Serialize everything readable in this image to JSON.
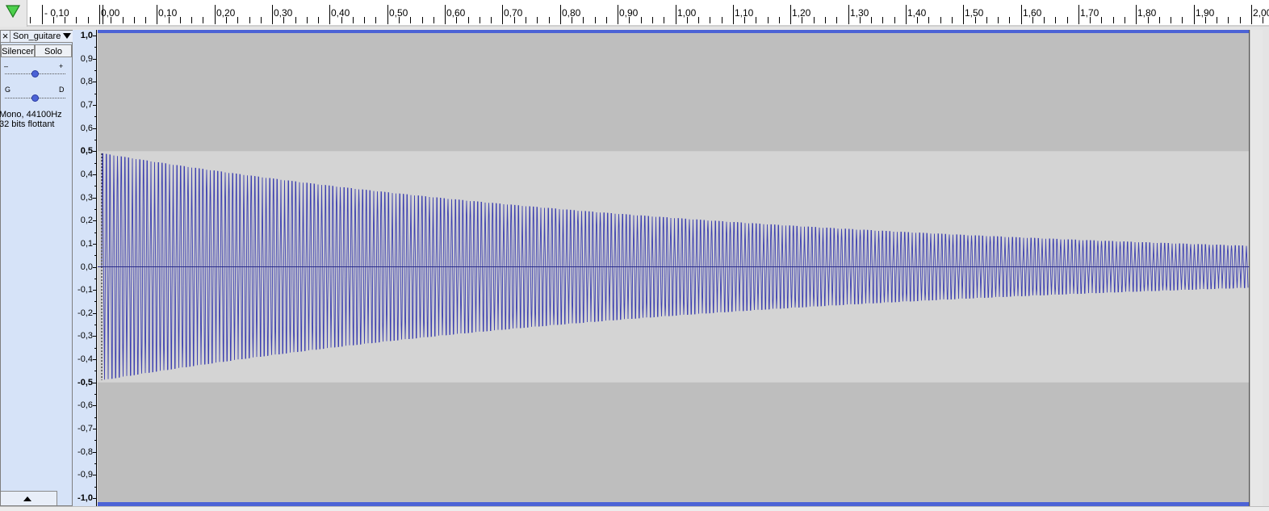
{
  "timeline": {
    "labels": [
      "- 0,10",
      "0,00",
      "0,10",
      "0,20",
      "0,30",
      "0,40",
      "0,50",
      "0,60",
      "0,70",
      "0,80",
      "0,90",
      "1,00",
      "1,10",
      "1,20",
      "1,30",
      "1,40",
      "1,50",
      "1,60",
      "1,70",
      "1,80",
      "1,90",
      "2,00"
    ],
    "values": [
      -0.1,
      0.0,
      0.1,
      0.2,
      0.3,
      0.4,
      0.5,
      0.6,
      0.7,
      0.8,
      0.9,
      1.0,
      1.1,
      1.2,
      1.3,
      1.4,
      1.5,
      1.6,
      1.7,
      1.8,
      1.9,
      2.0
    ]
  },
  "track": {
    "close_label": "×",
    "name": "Son_guitare",
    "mute_label": "Silencer",
    "solo_label": "Solo",
    "gain_minus": "–",
    "gain_plus": "+",
    "pan_left": "G",
    "pan_right": "D",
    "gain_level": 0.5,
    "pan_level": 0.5,
    "format_line1": "Mono, 44100Hz",
    "format_line2": "32 bits flottant"
  },
  "amplitude_ruler": {
    "labels": [
      "1,0",
      "0,9",
      "0,8",
      "0,7",
      "0,6",
      "0,5",
      "0,4",
      "0,3",
      "0,2",
      "0,1",
      "0,0",
      "-0,1",
      "-0,2",
      "-0,3",
      "-0,4",
      "-0,5",
      "-0,6",
      "-0,7",
      "-0,8",
      "-0,9",
      "-1,0"
    ],
    "values": [
      1.0,
      0.9,
      0.8,
      0.7,
      0.6,
      0.5,
      0.4,
      0.3,
      0.2,
      0.1,
      0.0,
      -0.1,
      -0.2,
      -0.3,
      -0.4,
      -0.5,
      -0.6,
      -0.7,
      -0.8,
      -0.9,
      -1.0
    ],
    "bold_labels": [
      "1,0",
      "0,5",
      "-0,5",
      "-1,0"
    ]
  },
  "waveform": {
    "start_time": 0.0,
    "end_time": 2.0,
    "start_amplitude": 0.49,
    "end_amplitude": 0.09,
    "highlight_range": [
      -0.5,
      0.5
    ],
    "colors": {
      "wave": "#3c3fb0",
      "background_outer": "#bebebe",
      "background_inner": "#d4d4d4",
      "center_line": "#2b2d8a",
      "border": "#4c63d6"
    }
  },
  "colors": {
    "panel": "#d6e3f8",
    "play_triangle": "#2eb82e"
  }
}
